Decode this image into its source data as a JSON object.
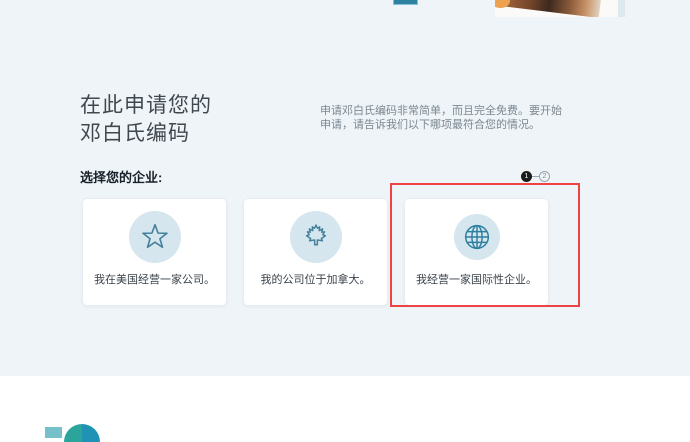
{
  "colors": {
    "background": "#eff4f8",
    "footer_background": "#ffffff",
    "accent_teal": "#2e81a0",
    "icon_circle_bg": "#d5e6ee",
    "icon_stroke": "#44809c",
    "highlight_red": "#ee4343",
    "step_active": "#1a1a1a",
    "logo_teal_light": "#76c0ca",
    "logo_teal_green": "#2ba49c",
    "logo_teal_blue": "#2092b3"
  },
  "heading": {
    "line1": "在此申请您的",
    "line2": "邓白氏编码"
  },
  "intro": {
    "text": "申请邓白氏编码非常简单，而且完全免费。要开始申请，请告诉我们以下哪项最符合您的情况。"
  },
  "selector": {
    "label": "选择您的企业:"
  },
  "steps": {
    "step1": "1",
    "step2": "2"
  },
  "cards": [
    {
      "icon": "star-icon",
      "label": "我在美国经营一家公司。"
    },
    {
      "icon": "maple-leaf-icon",
      "label": "我的公司位于加拿大。"
    },
    {
      "icon": "globe-icon",
      "label": "我经营一家国际性企业。",
      "highlighted": "true"
    }
  ]
}
